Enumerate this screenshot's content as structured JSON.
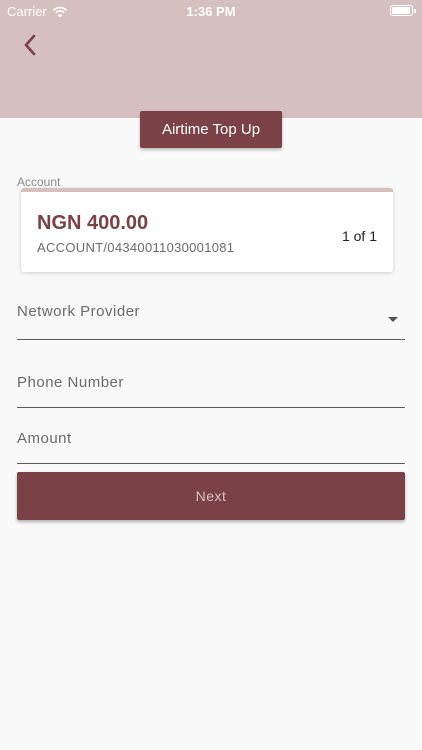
{
  "status_bar": {
    "carrier": "Carrier",
    "time": "1:36 PM",
    "wifi_icon": "wifi-icon",
    "battery_icon": "battery-icon"
  },
  "header": {
    "back_icon": "chevron-left-icon",
    "background_color": "#d6bfbf",
    "title": "Airtime Top Up"
  },
  "account": {
    "label": "Account",
    "balance": "NGN 400.00",
    "account_number": "ACCOUNT/04340011030001081",
    "pager": "1 of 1"
  },
  "form": {
    "network_provider": {
      "label": "Network Provider",
      "value": "",
      "dropdown_icon": "caret-down-icon"
    },
    "phone_number": {
      "label": "Phone Number",
      "value": ""
    },
    "amount": {
      "label": "Amount",
      "value": ""
    }
  },
  "actions": {
    "next_label": "Next",
    "accent_color": "#7a4147"
  }
}
